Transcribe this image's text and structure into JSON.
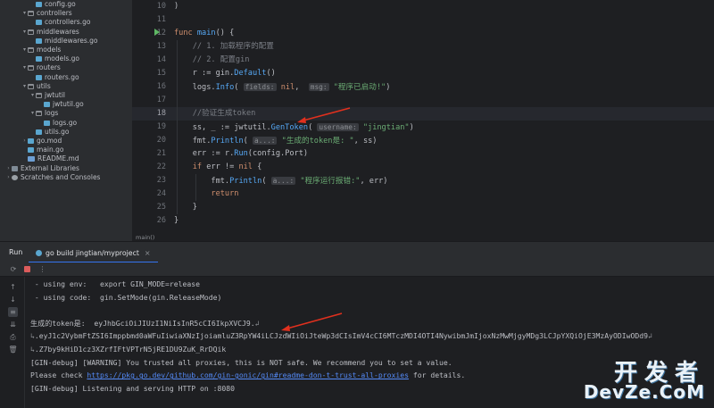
{
  "project_tree": [
    {
      "label": "config.go",
      "type": "go",
      "indent": 3,
      "chev": ""
    },
    {
      "label": "controllers",
      "type": "folder",
      "indent": 2,
      "chev": "▾"
    },
    {
      "label": "controllers.go",
      "type": "go",
      "indent": 3,
      "chev": ""
    },
    {
      "label": "middlewares",
      "type": "folder",
      "indent": 2,
      "chev": "▾"
    },
    {
      "label": "middlewares.go",
      "type": "go",
      "indent": 3,
      "chev": ""
    },
    {
      "label": "models",
      "type": "folder",
      "indent": 2,
      "chev": "▾"
    },
    {
      "label": "models.go",
      "type": "go",
      "indent": 3,
      "chev": ""
    },
    {
      "label": "routers",
      "type": "folder",
      "indent": 2,
      "chev": "▾"
    },
    {
      "label": "routers.go",
      "type": "go",
      "indent": 3,
      "chev": ""
    },
    {
      "label": "utils",
      "type": "folder",
      "indent": 2,
      "chev": "▾"
    },
    {
      "label": "jwtutil",
      "type": "folder",
      "indent": 3,
      "chev": "▾"
    },
    {
      "label": "jwtutil.go",
      "type": "go",
      "indent": 4,
      "chev": ""
    },
    {
      "label": "logs",
      "type": "folder",
      "indent": 3,
      "chev": "▾"
    },
    {
      "label": "logs.go",
      "type": "go",
      "indent": 4,
      "chev": ""
    },
    {
      "label": "utils.go",
      "type": "go",
      "indent": 3,
      "chev": ""
    },
    {
      "label": "go.mod",
      "type": "go",
      "indent": 2,
      "chev": "›"
    },
    {
      "label": "main.go",
      "type": "go",
      "indent": 2,
      "chev": ""
    },
    {
      "label": "README.md",
      "type": "md",
      "indent": 2,
      "chev": ""
    },
    {
      "label": "External Libraries",
      "type": "lib",
      "indent": 0,
      "chev": "›"
    },
    {
      "label": "Scratches and Consoles",
      "type": "scratch",
      "indent": 0,
      "chev": "›"
    }
  ],
  "editor": {
    "line_numbers": [
      "10",
      "11",
      "12",
      "13",
      "14",
      "15",
      "16",
      "17",
      "18",
      "19",
      "20",
      "21",
      "22",
      "23",
      "24",
      "25",
      "26"
    ],
    "current_line": "18",
    "lines": [
      [
        {
          "c": "pl",
          "t": ")"
        }
      ],
      [],
      [
        {
          "c": "kw",
          "t": "func "
        },
        {
          "c": "fn",
          "t": "main"
        },
        {
          "c": "pl",
          "t": "() {"
        }
      ],
      [
        {
          "c": "pl",
          "t": "    "
        },
        {
          "c": "cm",
          "t": "// 1. 加载程序的配置"
        }
      ],
      [
        {
          "c": "pl",
          "t": "    "
        },
        {
          "c": "cm",
          "t": "// 2. 配置gin"
        }
      ],
      [
        {
          "c": "pl",
          "t": "    r := gin."
        },
        {
          "c": "fn",
          "t": "Default"
        },
        {
          "c": "pl",
          "t": "()"
        }
      ],
      [
        {
          "c": "pl",
          "t": "    logs."
        },
        {
          "c": "fn",
          "t": "Info"
        },
        {
          "c": "pl",
          "t": "( "
        },
        {
          "c": "hint",
          "t": "fields:"
        },
        {
          "c": "pl",
          "t": " "
        },
        {
          "c": "kw",
          "t": "nil"
        },
        {
          "c": "pl",
          "t": ",  "
        },
        {
          "c": "hint",
          "t": "msg:"
        },
        {
          "c": "pl",
          "t": " "
        },
        {
          "c": "str",
          "t": "\"程序已启动!\""
        },
        {
          "c": "pl",
          "t": ")"
        }
      ],
      [],
      [
        {
          "c": "pl",
          "t": "    "
        },
        {
          "c": "cm",
          "t": "//验证生成token"
        }
      ],
      [
        {
          "c": "pl",
          "t": "    ss, _ := jwtutil."
        },
        {
          "c": "fn",
          "t": "GenToken"
        },
        {
          "c": "pl",
          "t": "( "
        },
        {
          "c": "hint",
          "t": "username:"
        },
        {
          "c": "pl",
          "t": " "
        },
        {
          "c": "str",
          "t": "\"jingtian\""
        },
        {
          "c": "pl",
          "t": ")"
        }
      ],
      [
        {
          "c": "pl",
          "t": "    fmt."
        },
        {
          "c": "fn",
          "t": "Println"
        },
        {
          "c": "pl",
          "t": "( "
        },
        {
          "c": "hint",
          "t": "a...:"
        },
        {
          "c": "pl",
          "t": " "
        },
        {
          "c": "str",
          "t": "\"生成的token是: \""
        },
        {
          "c": "pl",
          "t": ", ss)"
        }
      ],
      [
        {
          "c": "pl",
          "t": "    err := r."
        },
        {
          "c": "fn",
          "t": "Run"
        },
        {
          "c": "pl",
          "t": "(config.Port)"
        }
      ],
      [
        {
          "c": "pl",
          "t": "    "
        },
        {
          "c": "kw",
          "t": "if "
        },
        {
          "c": "pl",
          "t": "err != "
        },
        {
          "c": "kw",
          "t": "nil "
        },
        {
          "c": "pl",
          "t": "{"
        }
      ],
      [
        {
          "c": "pl",
          "t": "        fmt."
        },
        {
          "c": "fn",
          "t": "Println"
        },
        {
          "c": "pl",
          "t": "( "
        },
        {
          "c": "hint",
          "t": "a...:"
        },
        {
          "c": "pl",
          "t": " "
        },
        {
          "c": "str",
          "t": "\"程序运行报错:\""
        },
        {
          "c": "pl",
          "t": ", err)"
        }
      ],
      [
        {
          "c": "pl",
          "t": "        "
        },
        {
          "c": "kw",
          "t": "return"
        }
      ],
      [
        {
          "c": "pl",
          "t": "    }"
        }
      ],
      [
        {
          "c": "pl",
          "t": "}"
        }
      ]
    ],
    "breadcrumb": "main()"
  },
  "run_panel": {
    "title": "Run",
    "tab_label": "go build jingtian/myproject",
    "tab_close": "×",
    "console_lines": [
      {
        "segs": [
          {
            "t": " - using env:   export GIN_MODE=release"
          }
        ]
      },
      {
        "segs": [
          {
            "t": " - using code:  gin.SetMode(gin.ReleaseMode)"
          }
        ]
      },
      {
        "segs": [
          {
            "t": ""
          }
        ]
      },
      {
        "segs": [
          {
            "t": "生成的token是:  eyJhbGciOiJIUzI1NiIsInR5cCI6IkpXVCJ9."
          },
          {
            "t": "↲",
            "c": "wrapmark"
          }
        ]
      },
      {
        "segs": [
          {
            "t": "↳",
            "c": "wrapmark"
          },
          {
            "t": ".eyJ1c2VybmFtZSI6Imppbmd0aWFuIiwiaXNzIjoiamluZ3RpYW4iLCJzdWIiOiJteWp3dCIsImV4cCI6MTczMDI4OTI4NywibmJmIjoxNzMwMjgyMDg3LCJpYXQiOjE3MzAyODIwODd9"
          },
          {
            "t": "↲",
            "c": "wrapmark"
          }
        ]
      },
      {
        "segs": [
          {
            "t": "↳",
            "c": "wrapmark"
          },
          {
            "t": ".Z7by9kHiD1cz3XZrfIFtVPTrN5jRE1DU9ZuK_RrDQik"
          }
        ]
      },
      {
        "segs": [
          {
            "t": "[GIN-debug] [WARNING] You trusted all proxies, this is NOT safe. We recommend you to set a value."
          }
        ]
      },
      {
        "segs": [
          {
            "t": "Please check "
          },
          {
            "t": "https://pkg.go.dev/github.com/gin-gonic/gin#readme-don-t-trust-all-proxies",
            "c": "link"
          },
          {
            "t": " for details."
          }
        ]
      },
      {
        "segs": [
          {
            "t": "[GIN-debug] Listening and serving HTTP on :8080"
          }
        ]
      }
    ]
  },
  "watermark": {
    "cn": "开发者",
    "en": "DevZe.CoM"
  },
  "icons": [
    "rerun-icon",
    "stop-icon",
    "more-icon",
    "up-arrow-icon",
    "down-arrow-icon",
    "soft-wrap-icon",
    "scroll-end-icon",
    "print-icon",
    "trash-icon",
    "run-gutter-icon",
    "arrow-annotation"
  ],
  "colors": {
    "keyword": "#cf8e6d",
    "function": "#56a8f5",
    "comment": "#7a7e85",
    "string": "#6aab73",
    "link": "#548af7",
    "annotation_arrow": "#e0301e"
  }
}
